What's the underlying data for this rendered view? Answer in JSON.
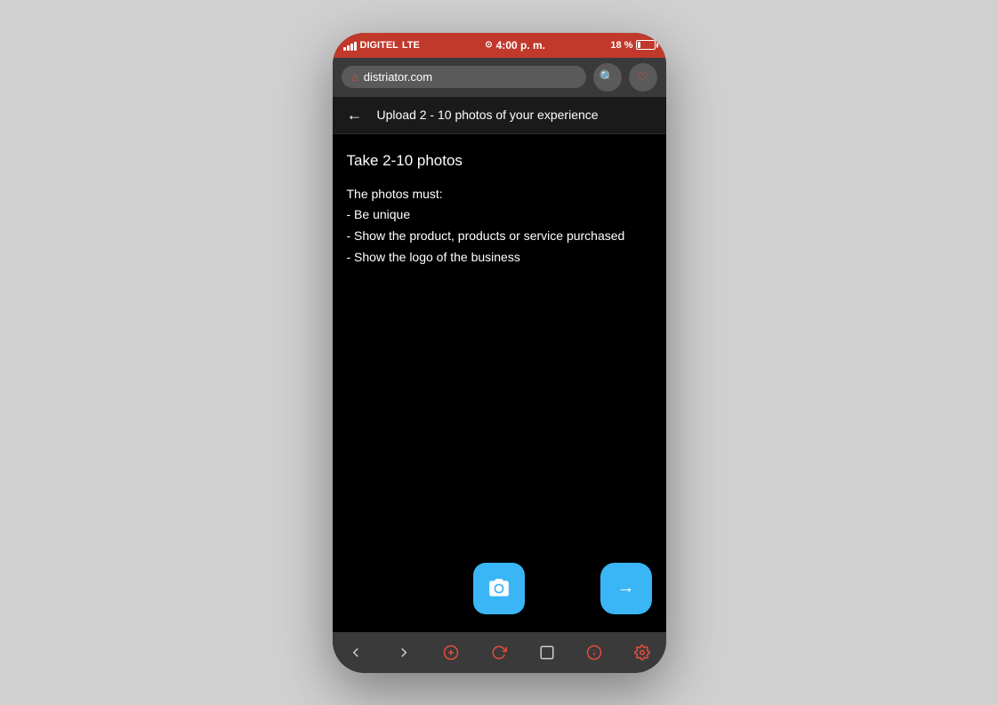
{
  "statusBar": {
    "carrier": "DIGITEL",
    "network": "LTE",
    "time": "4:00 p. m.",
    "battery": "18 %"
  },
  "browserBar": {
    "url": "distriator.com"
  },
  "pageHeader": {
    "title": "Upload 2 - 10 photos of your experience",
    "backLabel": "←"
  },
  "mainContent": {
    "sectionTitle": "Take 2-10 photos",
    "requirementsLabel": "The photos must:",
    "requirements": [
      "- Be unique",
      "- Show the product, products or service purchased",
      "- Show the logo of the business"
    ]
  },
  "actions": {
    "cameraLabel": "camera",
    "nextLabel": "→"
  }
}
